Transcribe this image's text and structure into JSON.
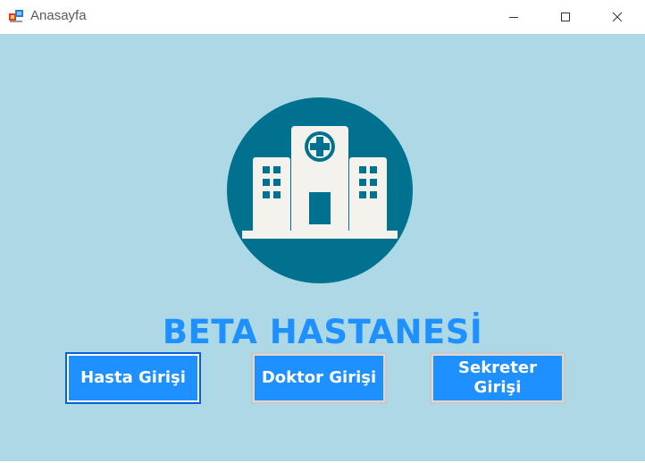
{
  "window": {
    "title": "Anasayfa",
    "controls": {
      "minimize_icon": "minimize-icon",
      "maximize_icon": "maximize-icon",
      "close_icon": "close-icon"
    }
  },
  "main": {
    "logo_icon": "hospital-icon",
    "heading": "BETA HASTANESİ",
    "buttons": {
      "hasta": "Hasta Girişi",
      "doktor": "Doktor Girişi",
      "sekreter_line1": "Sekreter",
      "sekreter_line2": "Girişi"
    }
  },
  "colors": {
    "background": "#add8e6",
    "accent": "#1e90ff",
    "logo_circle": "#00718f",
    "logo_building": "#f4f2ec"
  }
}
